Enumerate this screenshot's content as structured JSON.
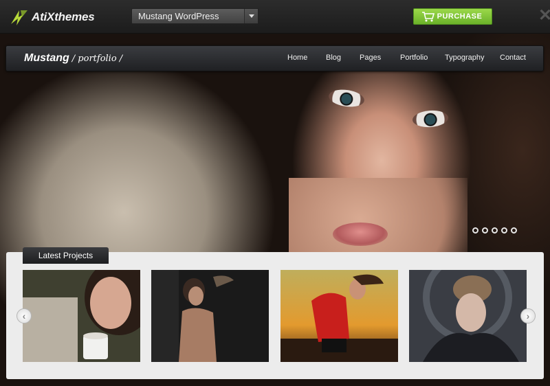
{
  "topbar": {
    "brand": "AtiXthemes",
    "theme_select": "Mustang WordPress",
    "purchase_label": "PURCHASE"
  },
  "nav": {
    "site_title": "Mustang",
    "site_subtitle": "/ portfolio /",
    "items": [
      "Home",
      "Blog",
      "Pages",
      "Portfolio",
      "Typography",
      "Contact"
    ]
  },
  "slider": {
    "dot_count": 5
  },
  "projects": {
    "heading": "Latest Projects"
  },
  "colors": {
    "purchase_green": "#7cc536",
    "panel_bg": "#ececec",
    "nav_bg": "#2a2b2e"
  }
}
